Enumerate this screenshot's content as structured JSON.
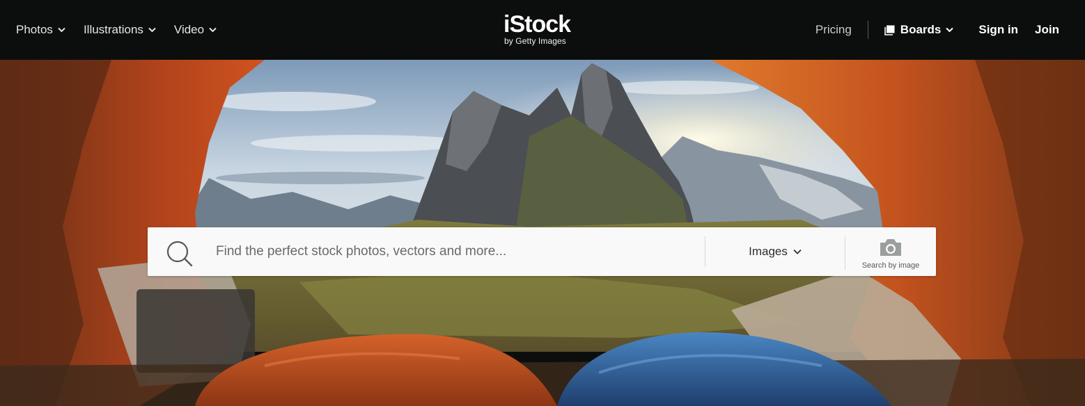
{
  "header": {
    "nav_left": [
      {
        "label": "Photos"
      },
      {
        "label": "Illustrations"
      },
      {
        "label": "Video"
      }
    ],
    "logo": {
      "main": "iStock",
      "sub": "by Getty Images"
    },
    "pricing": "Pricing",
    "boards": "Boards",
    "sign_in": "Sign in",
    "join": "Join"
  },
  "search": {
    "placeholder": "Find the perfect stock photos, vectors and more...",
    "type_selected": "Images",
    "by_image_label": "Search by image"
  },
  "colors": {
    "header_bg": "#0c0e0d",
    "search_bg": "#f9f9f9",
    "tent_orange": "#c0491c",
    "sleeping_bag_blue": "#2c5c9a"
  }
}
